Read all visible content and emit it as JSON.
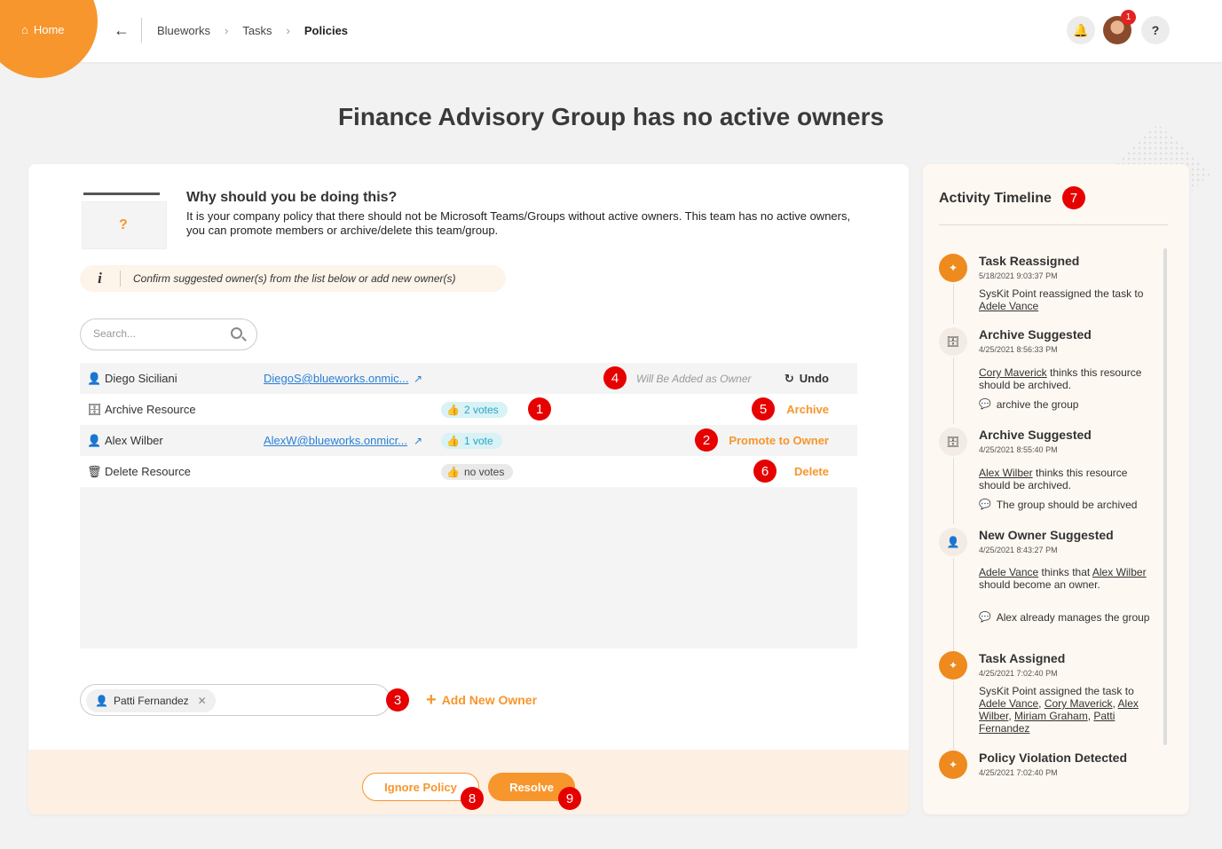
{
  "header": {
    "home_label": "Home",
    "breadcrumbs": [
      "Blueworks",
      "Tasks",
      "Policies"
    ],
    "notification_count": "1",
    "help_label": "?"
  },
  "page_title": "Finance Advisory Group has no active owners",
  "why": {
    "title": "Why should you be doing this?",
    "body": "It is your company policy that there should not be Microsoft Teams/Groups without active owners. This team has no active owners, you can promote members or archive/delete this team/group."
  },
  "info": "Confirm suggested owner(s) from the list below or add new owner(s)",
  "search": {
    "placeholder": "Search..."
  },
  "rows": [
    {
      "name": "Diego Siciliani",
      "email": "DiegoS@blueworks.onmic...",
      "status": "Will Be Added as Owner",
      "action": "Undo",
      "marker": "4"
    },
    {
      "name": "Archive Resource",
      "votes": "2 votes",
      "action": "Archive",
      "vote_marker": "1",
      "marker": "5"
    },
    {
      "name": "Alex Wilber",
      "email": "AlexW@blueworks.onmicr...",
      "votes": "1 vote",
      "action": "Promote to Owner",
      "marker": "2"
    },
    {
      "name": "Delete Resource",
      "votes": "no votes",
      "action": "Delete",
      "marker": "6"
    }
  ],
  "new_owner": {
    "chip": "Patti Fernandez",
    "marker": "3",
    "add_label": "Add New Owner"
  },
  "footer": {
    "ignore_label": "Ignore Policy",
    "ignore_marker": "8",
    "resolve_label": "Resolve",
    "resolve_marker": "9"
  },
  "timeline": {
    "title": "Activity Timeline",
    "marker": "7",
    "items": [
      {
        "heading": "Task Reassigned",
        "time": "5/18/2021 9:03:37 PM",
        "text": "SysKit Point reassigned the task to",
        "people": [
          "Adele Vance"
        ]
      },
      {
        "heading": "Archive Suggested",
        "time": "4/25/2021 8:56:33 PM",
        "people": [
          "Cory Maverick"
        ],
        "text": "thinks this resource should be archived.",
        "comment": "archive the group"
      },
      {
        "heading": "Archive Suggested",
        "time": "4/25/2021 8:55:40 PM",
        "people": [
          "Alex Wilber"
        ],
        "text": "thinks this resource should be archived.",
        "comment": "The group should be archived"
      },
      {
        "heading": "New Owner Suggested",
        "time": "4/25/2021 8:43:27 PM",
        "people": [
          "Adele Vance",
          "Alex Wilber"
        ],
        "text_a": "thinks that",
        "text_b": "should become an owner.",
        "comment": "Alex already manages the group"
      },
      {
        "heading": "Task Assigned",
        "time": "4/25/2021 7:02:40 PM",
        "text": "SysKit Point assigned the task to",
        "people": [
          "Adele Vance",
          "Cory Maverick",
          "Alex Wilber",
          "Miriam Graham",
          "Patti Fernandez"
        ]
      },
      {
        "heading": "Policy Violation Detected",
        "time": "4/25/2021 7:02:40 PM"
      }
    ]
  },
  "colors": {
    "accent": "#f7962c",
    "marker": "#e60000",
    "link": "#2a7fd6",
    "vote": "#2aa6c2"
  }
}
